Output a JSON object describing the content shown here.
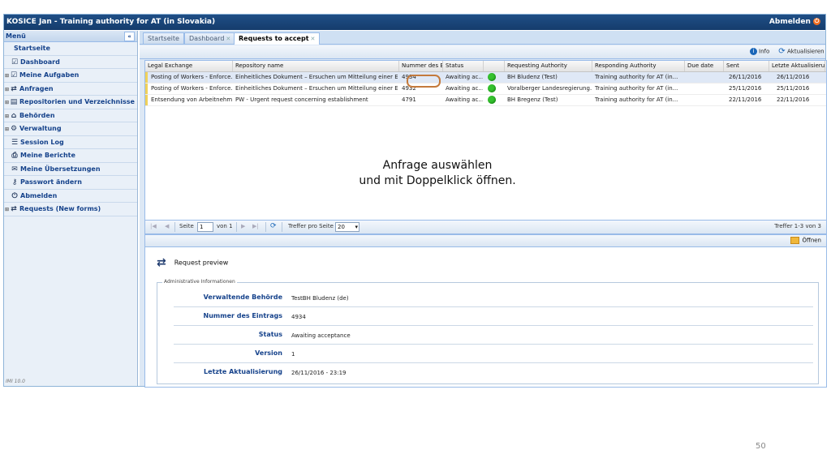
{
  "window": {
    "title": "KOSICE Jan - Training authority for AT (in Slovakia)",
    "logout_label": "Abmelden"
  },
  "sidebar": {
    "header": "Menü",
    "items": [
      {
        "label": "Startseite",
        "icon": "none",
        "expandable": false
      },
      {
        "label": "Dashboard",
        "icon": "checklist-icon",
        "expandable": false
      },
      {
        "label": "Meine Aufgaben",
        "icon": "checklist-icon",
        "expandable": true
      },
      {
        "label": "Anfragen",
        "icon": "exchange-arrows-icon",
        "expandable": true
      },
      {
        "label": "Repositorien und Verzeichnisse",
        "icon": "repository-icon",
        "expandable": true
      },
      {
        "label": "Behörden",
        "icon": "building-icon",
        "expandable": true
      },
      {
        "label": "Verwaltung",
        "icon": "gear-icon",
        "expandable": true
      },
      {
        "label": "Session Log",
        "icon": "list-icon",
        "expandable": false
      },
      {
        "label": "Meine Berichte",
        "icon": "printer-icon",
        "expandable": false
      },
      {
        "label": "Meine Übersetzungen",
        "icon": "speech-bubbles-icon",
        "expandable": false
      },
      {
        "label": "Passwort ändern",
        "icon": "key-icon",
        "expandable": false
      },
      {
        "label": "Abmelden",
        "icon": "power-icon",
        "expandable": false
      },
      {
        "label": "Requests (New forms)",
        "icon": "exchange-arrows-icon",
        "expandable": true
      }
    ],
    "footer": "IMI 10.0"
  },
  "tabs": [
    {
      "label": "Startseite",
      "closable": false
    },
    {
      "label": "Dashboard",
      "closable": true
    },
    {
      "label": "Requests to accept",
      "closable": true,
      "active": true
    }
  ],
  "toolbar": {
    "info_label": "Info",
    "refresh_label": "Aktualisieren"
  },
  "grid": {
    "columns": [
      "Legal Exchange",
      "Repository name",
      "Nummer des Ei",
      "Status",
      "",
      "Requesting Authority",
      "Responding Authority",
      "Due date",
      "Sent",
      "Letzte Aktualisieru"
    ],
    "rows": [
      {
        "legal": "Posting of Workers - Enforce...",
        "repo": "Einheitliches Dokument – Ersuchen um Mitteilung einer En...",
        "num": "4934",
        "status": "Awaiting ac...",
        "req": "BH Bludenz (Test)",
        "resp": "Training authority for AT (in...",
        "due": "",
        "sent": "26/11/2016",
        "updated": "26/11/2016"
      },
      {
        "legal": "Posting of Workers - Enforce...",
        "repo": "Einheitliches Dokument – Ersuchen um Mitteilung einer En...",
        "num": "4932",
        "status": "Awaiting ac...",
        "req": "Voralberger Landesregierung...",
        "resp": "Training authority for AT (in...",
        "due": "",
        "sent": "25/11/2016",
        "updated": "25/11/2016"
      },
      {
        "legal": "Entsendung von Arbeitnehm...",
        "repo": "PW - Urgent request concerning establishment",
        "num": "4791",
        "status": "Awaiting ac...",
        "req": "BH Bregenz (Test)",
        "resp": "Training authority for AT (in...",
        "due": "",
        "sent": "22/11/2016",
        "updated": "22/11/2016"
      }
    ]
  },
  "overlay": {
    "line1": "Anfrage auswählen",
    "line2": "und mit Doppelklick öffnen."
  },
  "pager": {
    "page_label": "Seite",
    "page_value": "1",
    "of_label": "von 1",
    "per_page_label": "Treffer pro Seite",
    "per_page_value": "20",
    "summary": "Treffer 1-3 von 3"
  },
  "detail": {
    "open_label": "Öffnen",
    "preview_label": "Request preview",
    "section_legend": "Administrative Informationen",
    "fields": [
      {
        "label": "Verwaltende Behörde",
        "value": "TestBH Bludenz (de)"
      },
      {
        "label": "Nummer des Eintrags",
        "value": "4934"
      },
      {
        "label": "Status",
        "value": "Awaiting acceptance"
      },
      {
        "label": "Version",
        "value": "1"
      },
      {
        "label": "Letzte Aktualisierung",
        "value": "26/11/2016 - 23:19"
      }
    ]
  },
  "slide_number": "50",
  "colors": {
    "title_bar": "#1f4f86",
    "accent": "#15428b",
    "status_ok": "#35c22f",
    "highlight": "#c47a3c"
  }
}
